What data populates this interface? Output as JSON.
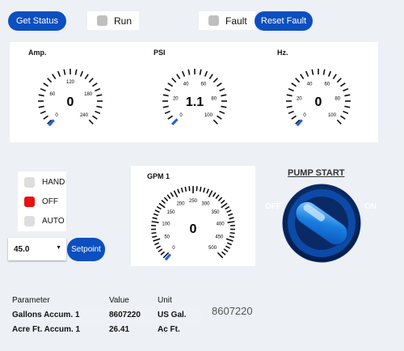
{
  "top_bar": {
    "get_status_label": "Get Status",
    "run_label": "Run",
    "fault_label": "Fault",
    "reset_fault_label": "Reset Fault"
  },
  "gauges": [
    {
      "title": "Amp.",
      "value": "0",
      "ticks": [
        "0",
        "60",
        "120",
        "180",
        "240"
      ],
      "value_fraction": 0
    },
    {
      "title": "PSI",
      "value": "1.1",
      "ticks": [
        "0",
        "20",
        "40",
        "60",
        "80",
        "100"
      ],
      "value_fraction": 0.011
    },
    {
      "title": "Hz.",
      "value": "0",
      "ticks": [
        "0",
        "20",
        "40",
        "60",
        "80",
        "100"
      ],
      "value_fraction": 0
    }
  ],
  "gpm_gauge": {
    "title": "GPM 1",
    "value": "0",
    "ticks": [
      "0",
      "50",
      "100",
      "150",
      "200",
      "250",
      "300",
      "350",
      "400",
      "450",
      "500"
    ],
    "value_fraction": 0
  },
  "mode": {
    "hand_label": "HAND",
    "off_label": "OFF",
    "auto_label": "AUTO",
    "active": "OFF"
  },
  "setpoint": {
    "value": "45.0",
    "button_label": "Setpoint"
  },
  "pump": {
    "title": "PUMP START",
    "off_label": "OFF",
    "on_label": "ON"
  },
  "table": {
    "headers": [
      "Parameter",
      "Value",
      "Unit"
    ],
    "rows": [
      [
        "Gallons Accum. 1",
        "8607220",
        "US Gal."
      ],
      [
        "Acre Ft. Accum. 1",
        "26.41",
        "Ac Ft."
      ]
    ]
  },
  "readout": "8607220",
  "colors": {
    "accent": "#0b4fc0",
    "off_lamp": "#e81010",
    "indicator_gray": "#bfbfbf"
  }
}
